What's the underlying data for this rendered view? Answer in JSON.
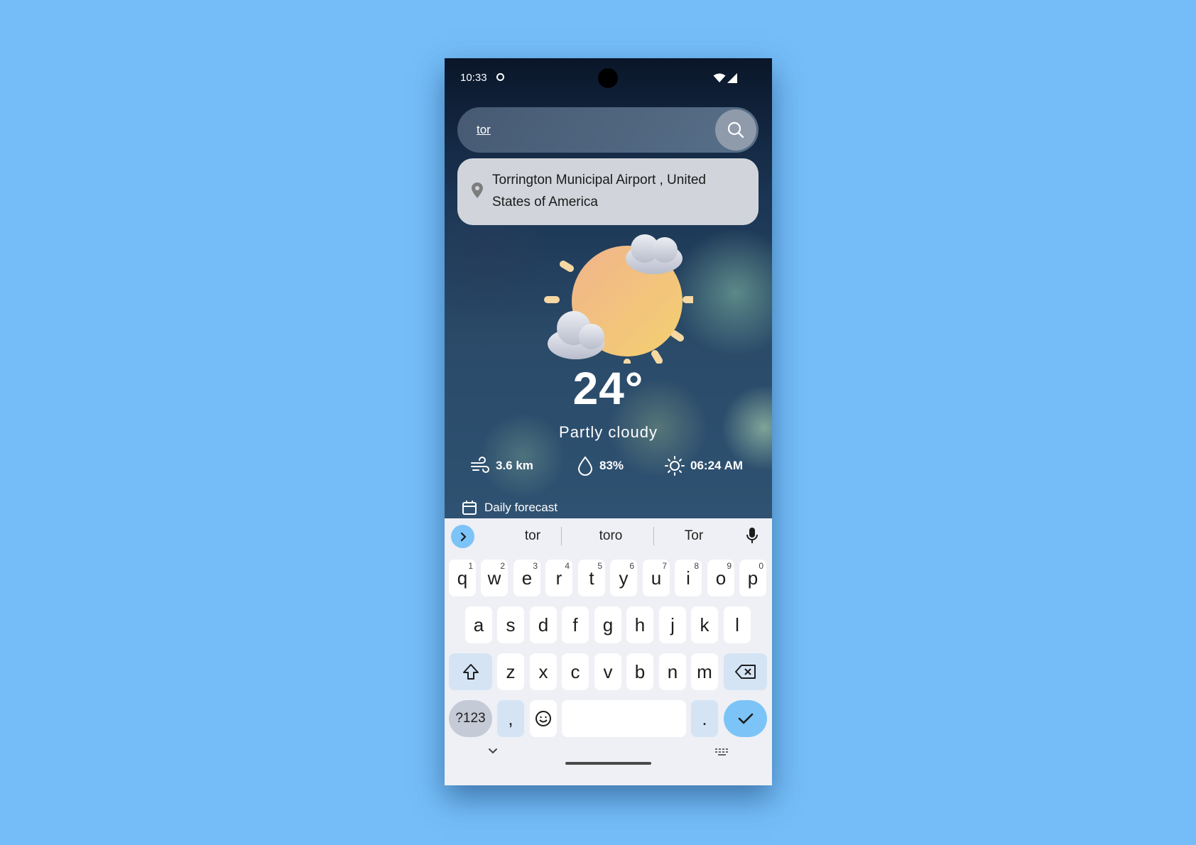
{
  "status_bar": {
    "time": "10:33",
    "icons": [
      "data-saver-icon",
      "wifi-icon",
      "signal-icon"
    ]
  },
  "search": {
    "value": "tor",
    "icon": "search-icon"
  },
  "suggestion": {
    "icon": "location-pin-icon",
    "text": "Torrington Municipal Airport , United States of America"
  },
  "weather": {
    "icon": "partly-cloudy-icon",
    "temperature": "24°",
    "condition": "Partly cloudy",
    "stats": [
      {
        "icon": "wind-icon",
        "value": "3.6 km"
      },
      {
        "icon": "humidity-drop-icon",
        "value": "83%"
      },
      {
        "icon": "sunrise-sun-icon",
        "value": "06:24 AM"
      }
    ],
    "daily_forecast_label": "Daily forecast"
  },
  "keyboard": {
    "suggestions": [
      "tor",
      "toro",
      "Tor"
    ],
    "row1": [
      {
        "k": "q",
        "h": "1"
      },
      {
        "k": "w",
        "h": "2"
      },
      {
        "k": "e",
        "h": "3"
      },
      {
        "k": "r",
        "h": "4"
      },
      {
        "k": "t",
        "h": "5"
      },
      {
        "k": "y",
        "h": "6"
      },
      {
        "k": "u",
        "h": "7"
      },
      {
        "k": "i",
        "h": "8"
      },
      {
        "k": "o",
        "h": "9"
      },
      {
        "k": "p",
        "h": "0"
      }
    ],
    "row2": [
      "a",
      "s",
      "d",
      "f",
      "g",
      "h",
      "j",
      "k",
      "l"
    ],
    "row3": [
      "z",
      "x",
      "c",
      "v",
      "b",
      "n",
      "m"
    ],
    "symbols_label": "?123",
    "comma": ",",
    "period": "."
  },
  "colors": {
    "page_background": "#74bdf8",
    "accent": "#7cc4f7",
    "suggestion_card": "#d1d5db",
    "sun": "#f3c37a"
  }
}
